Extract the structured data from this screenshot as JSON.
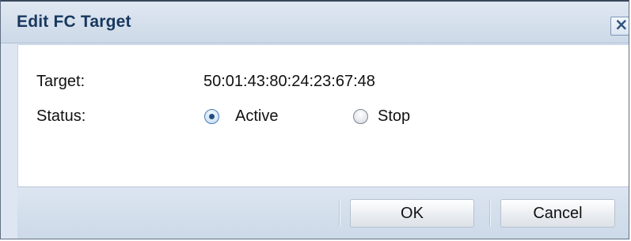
{
  "dialog": {
    "title": "Edit FC Target",
    "close_label": "×"
  },
  "form": {
    "target_label": "Target:",
    "target_value": "50:01:43:80:24:23:67:48",
    "status_label": "Status:",
    "status_options": [
      {
        "label": "Active",
        "selected": true
      },
      {
        "label": "Stop",
        "selected": false
      }
    ]
  },
  "footer": {
    "ok_label": "OK",
    "cancel_label": "Cancel"
  },
  "colors": {
    "title_text": "#17385f",
    "frame_bg": "#dde6f2",
    "content_bg": "#ffffff"
  },
  "icons": {
    "close": "close-icon",
    "radio_checked": "radio-checked-icon",
    "radio_unchecked": "radio-unchecked-icon"
  }
}
